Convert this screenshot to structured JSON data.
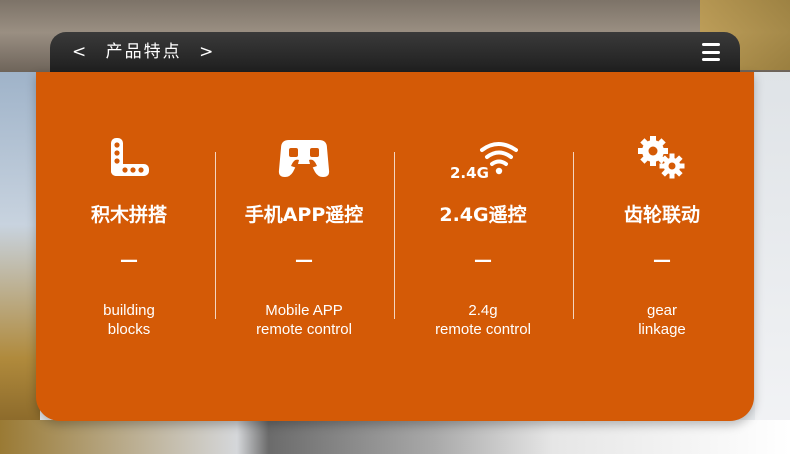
{
  "header": {
    "prev_arrow": "<",
    "title": "产品特点",
    "next_arrow": ">"
  },
  "features": [
    {
      "icon": "building-blocks-icon",
      "title": "积木拼搭",
      "dash": "—",
      "desc_line1": "building",
      "desc_line2": "blocks"
    },
    {
      "icon": "gamepad-remote-icon",
      "title": "手机APP遥控",
      "dash": "—",
      "desc_line1": "Mobile APP",
      "desc_line2": "remote control"
    },
    {
      "icon": "wifi-signal-icon",
      "icon_text": "2.4G",
      "title": "2.4G遥控",
      "dash": "—",
      "desc_line1": "2.4g",
      "desc_line2": "remote control"
    },
    {
      "icon": "gears-icon",
      "title": "齿轮联动",
      "dash": "—",
      "desc_line1": "gear",
      "desc_line2": "linkage"
    }
  ],
  "colors": {
    "card": "#d45a06",
    "header": "#2a2a2a",
    "text": "#ffffff"
  }
}
